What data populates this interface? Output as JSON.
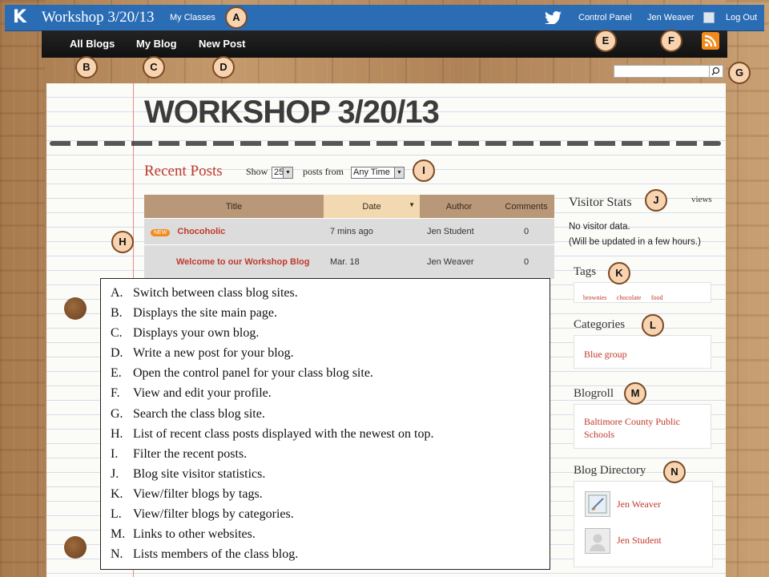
{
  "header": {
    "site_title": "Workshop 3/20/13",
    "my_classes": "My Classes",
    "control_panel": "Control Panel",
    "user_name": "Jen Weaver",
    "logout": "Log Out"
  },
  "nav": {
    "all_blogs": "All Blogs",
    "my_blog": "My Blog",
    "new_post": "New Post"
  },
  "search": {
    "placeholder": ""
  },
  "blog": {
    "title": "WORKSHOP 3/20/13"
  },
  "recent_posts": {
    "title": "Recent Posts",
    "show_label": "Show",
    "count_value": "25",
    "from_label": "posts from",
    "time_value": "Any Time",
    "columns": [
      "Title",
      "Date",
      "Author",
      "Comments"
    ],
    "rows": [
      {
        "badge": "NEW",
        "title": "Chocoholic",
        "date": "7 mins ago",
        "author": "Jen Student",
        "comments": "0"
      },
      {
        "badge": "",
        "title": "Welcome to our Workshop Blog",
        "date": "Mar. 18",
        "author": "Jen Weaver",
        "comments": "0"
      }
    ]
  },
  "sidebar": {
    "visitor_stats": {
      "title": "Visitor Stats",
      "views_label": "views",
      "line1": "No visitor data.",
      "line2": "(Will be updated in a few hours.)"
    },
    "tags": {
      "title": "Tags",
      "items": [
        "brownies",
        "chocolate",
        "food"
      ]
    },
    "categories": {
      "title": "Categories",
      "items": [
        "Blue group"
      ]
    },
    "blogroll": {
      "title": "Blogroll",
      "items": [
        "Baltimore County Public Schools"
      ]
    },
    "directory": {
      "title": "Blog Directory",
      "members": [
        "Jen Weaver",
        "Jen Student"
      ]
    }
  },
  "callouts": [
    "A",
    "B",
    "C",
    "D",
    "E",
    "F",
    "G",
    "H",
    "I",
    "J",
    "K",
    "L",
    "M",
    "N"
  ],
  "legend": [
    {
      "letter": "A.",
      "text": "Switch between class blog sites."
    },
    {
      "letter": "B.",
      "text": "Displays the site main page."
    },
    {
      "letter": "C.",
      "text": "Displays your own blog."
    },
    {
      "letter": "D.",
      "text": "Write a new post for your blog."
    },
    {
      "letter": "E.",
      "text": "Open the control panel for your class blog site."
    },
    {
      "letter": "F.",
      "text": "View and edit your profile."
    },
    {
      "letter": "G.",
      "text": "Search the class blog site."
    },
    {
      "letter": "H.",
      "text": "List of recent class posts displayed with the newest on top."
    },
    {
      "letter": "I.",
      "text": "Filter the recent posts."
    },
    {
      "letter": "J.",
      "text": "Blog site visitor statistics."
    },
    {
      "letter": "K.",
      "text": "View/filter blogs by tags."
    },
    {
      "letter": "L.",
      "text": "View/filter blogs by categories."
    },
    {
      "letter": "M.",
      "text": "Links to other websites."
    },
    {
      "letter": "N.",
      "text": "Lists members of the class blog."
    }
  ],
  "colors": {
    "topbar": "#2a6db5",
    "accent_red": "#c0392b",
    "rss_orange": "#f28a1e"
  }
}
